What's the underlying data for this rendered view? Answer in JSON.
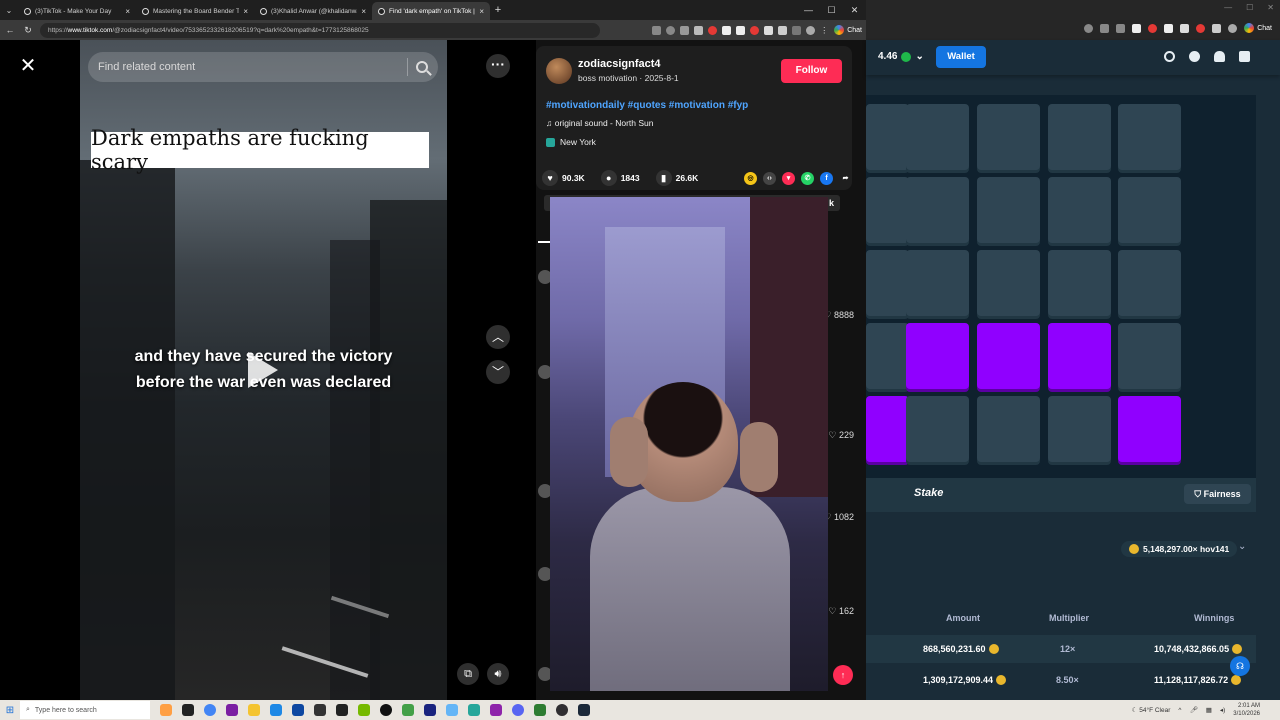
{
  "browser": {
    "tabs": [
      {
        "title": "(3)TikTok - Make Your Day",
        "active": false
      },
      {
        "title": "Mastering the Board Bender Tool",
        "active": false
      },
      {
        "title": "(3)Khalid Anwar (@khalidanwar_)",
        "active": false
      },
      {
        "title": "Find 'dark empath' on TikTok | Tik",
        "active": true
      }
    ],
    "url_prefix": "https://",
    "url_host": "www.tiktok.com",
    "url_path": "/@zodiacsignfact4/video/7533652332618206519?q=dark%20empath&t=1773125868025",
    "chat_label": "Chat"
  },
  "tiktok": {
    "search_placeholder": "Find related content",
    "caption_top": "Dark empaths are fucking scary",
    "caption_line1": "and they have secured the victory",
    "caption_line2": "before the war even was declared",
    "author": {
      "username": "zodiacsignfact4",
      "subline": "boss motivation · 2025-8-1",
      "follow_label": "Follow"
    },
    "hashtags": "#motivationdaily #quotes #motivation #fyp",
    "sound": "original sound - North Sun",
    "location": "New York",
    "stats": {
      "likes": "90.3K",
      "comments": "1843",
      "saves": "26.6K"
    },
    "tab_label_k": "k",
    "comment_likes": [
      "8888",
      "229",
      "1082",
      "162"
    ]
  },
  "stake": {
    "balance": "4.46",
    "wallet_label": "Wallet",
    "logo": "Stake",
    "fairness_label": "Fairness",
    "leader": "5,148,297.00× hov141",
    "grid_rows": [
      [
        false,
        false,
        false,
        false,
        false
      ],
      [
        false,
        false,
        false,
        false,
        false
      ],
      [
        false,
        false,
        false,
        false,
        false
      ],
      [
        false,
        true,
        true,
        true,
        false
      ],
      [
        true,
        false,
        false,
        false,
        true
      ]
    ],
    "table_headers": {
      "amount": "Amount",
      "multiplier": "Multiplier",
      "winnings": "Winnings"
    },
    "rows": [
      {
        "amount": "868,560,231.60",
        "multiplier": "12×",
        "winnings": "10,748,432,866.05"
      },
      {
        "amount": "1,309,172,909.44",
        "multiplier": "8.50×",
        "winnings": "11,128,117,826.72"
      }
    ],
    "colors": {
      "accent_purple": "#9000ff",
      "wallet_blue": "#1475e1",
      "tile": "#2f4553"
    }
  },
  "taskbar": {
    "search_placeholder": "Type here to search",
    "weather": "54°F Clear",
    "time": "2:01 AM",
    "date": "3/10/2026"
  }
}
